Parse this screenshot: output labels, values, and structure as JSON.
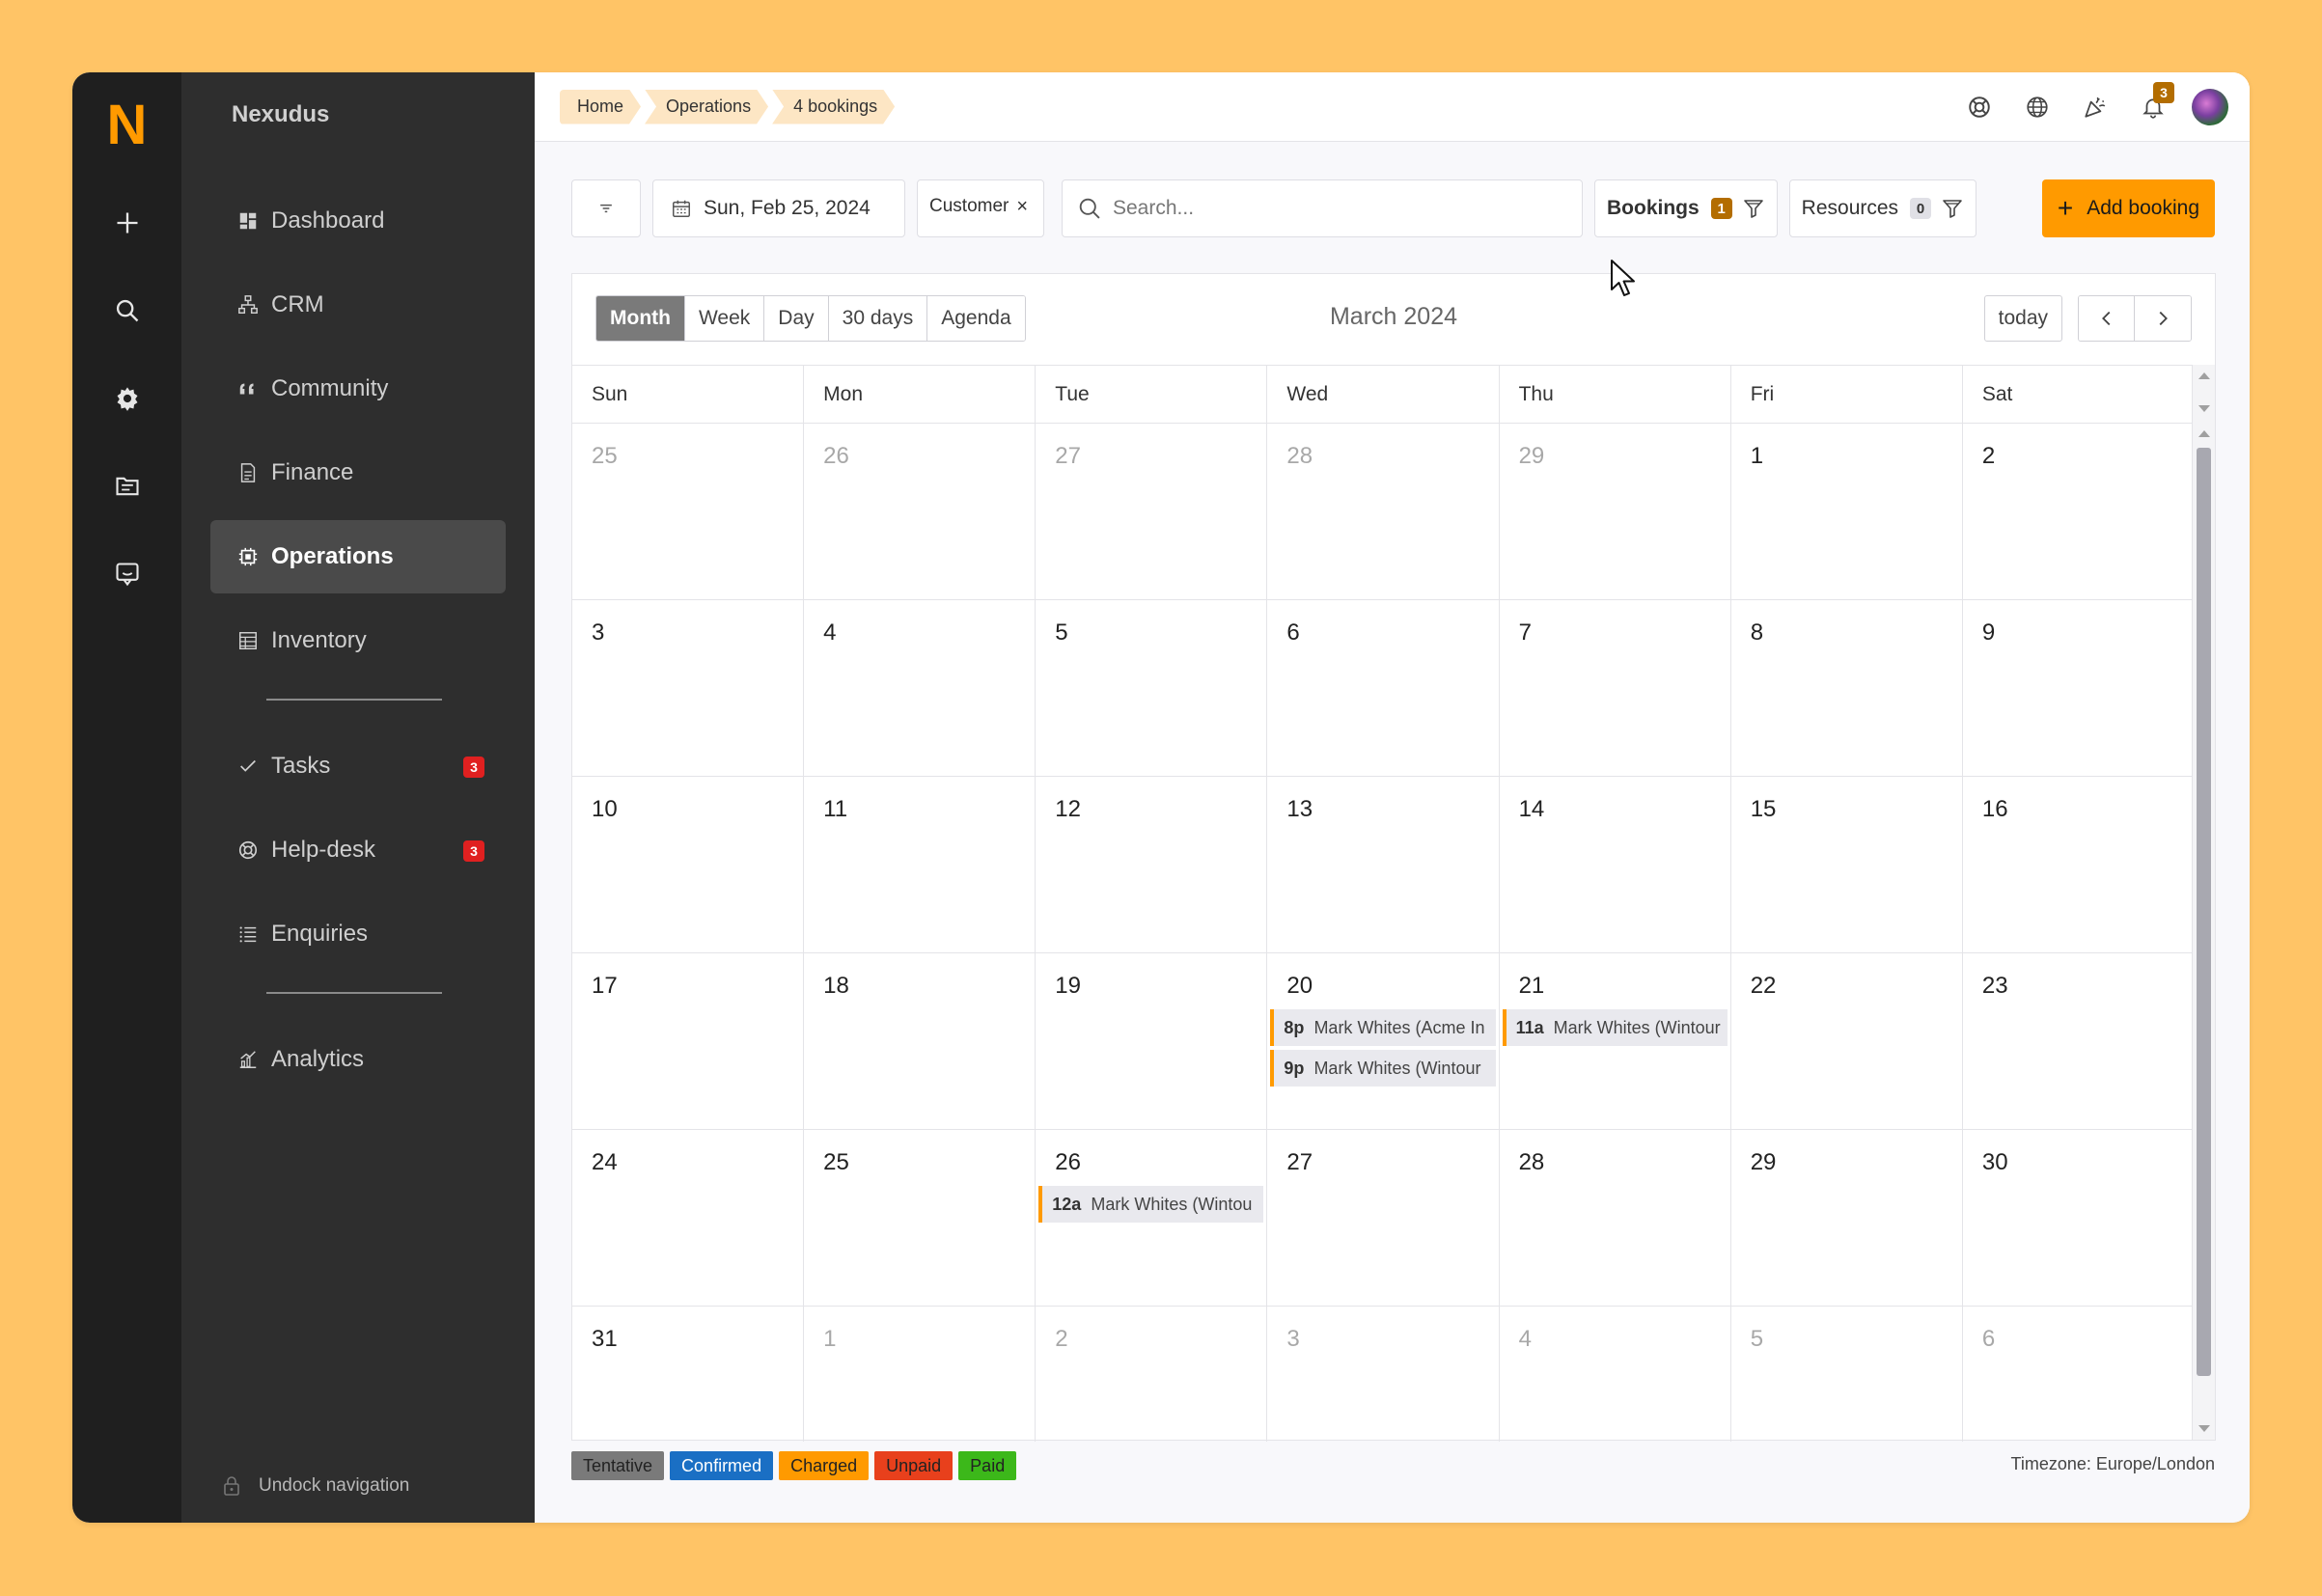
{
  "app": {
    "logo": "N",
    "brand": "Nexudus"
  },
  "rail": {
    "icons": [
      "plus-icon",
      "search-icon",
      "gear-icon",
      "folder-icon",
      "chat-icon"
    ]
  },
  "sidebar": {
    "items": [
      {
        "label": "Dashboard",
        "icon": "dashboard-icon"
      },
      {
        "label": "CRM",
        "icon": "crm-icon"
      },
      {
        "label": "Community",
        "icon": "quote-icon"
      },
      {
        "label": "Finance",
        "icon": "document-icon"
      },
      {
        "label": "Operations",
        "icon": "chip-icon",
        "active": true
      },
      {
        "label": "Inventory",
        "icon": "table-icon"
      }
    ],
    "items2": [
      {
        "label": "Tasks",
        "badge": "3"
      },
      {
        "label": "Help-desk",
        "badge": "3"
      },
      {
        "label": "Enquiries"
      }
    ],
    "items3": [
      {
        "label": "Analytics"
      }
    ],
    "undock": "Undock navigation"
  },
  "breadcrumb": [
    "Home",
    "Operations",
    "4 bookings"
  ],
  "topbar": {
    "notifications_count": "3"
  },
  "toolbar": {
    "date": "Sun, Feb 25, 2024",
    "customer_chip": "Customer",
    "search_placeholder": "Search...",
    "bookings_label": "Bookings",
    "bookings_count": "1",
    "resources_label": "Resources",
    "resources_count": "0",
    "add_label": "Add booking"
  },
  "calendar": {
    "views": [
      "Month",
      "Week",
      "Day",
      "30 days",
      "Agenda"
    ],
    "active_view": "Month",
    "title": "March 2024",
    "today_label": "today",
    "weekdays": [
      "Sun",
      "Mon",
      "Tue",
      "Wed",
      "Thu",
      "Fri",
      "Sat"
    ],
    "weeks": [
      [
        {
          "d": "25",
          "o": true
        },
        {
          "d": "26",
          "o": true
        },
        {
          "d": "27",
          "o": true
        },
        {
          "d": "28",
          "o": true
        },
        {
          "d": "29",
          "o": true
        },
        {
          "d": "1"
        },
        {
          "d": "2"
        }
      ],
      [
        {
          "d": "3"
        },
        {
          "d": "4"
        },
        {
          "d": "5"
        },
        {
          "d": "6"
        },
        {
          "d": "7"
        },
        {
          "d": "8"
        },
        {
          "d": "9"
        }
      ],
      [
        {
          "d": "10"
        },
        {
          "d": "11"
        },
        {
          "d": "12"
        },
        {
          "d": "13"
        },
        {
          "d": "14"
        },
        {
          "d": "15"
        },
        {
          "d": "16"
        }
      ],
      [
        {
          "d": "17"
        },
        {
          "d": "18"
        },
        {
          "d": "19"
        },
        {
          "d": "20",
          "events": [
            {
              "time": "8p",
              "title": "Mark Whites (Acme In"
            },
            {
              "time": "9p",
              "title": "Mark Whites (Wintour"
            }
          ]
        },
        {
          "d": "21",
          "events": [
            {
              "time": "11a",
              "title": "Mark Whites (Wintour"
            }
          ]
        },
        {
          "d": "22"
        },
        {
          "d": "23"
        }
      ],
      [
        {
          "d": "24"
        },
        {
          "d": "25"
        },
        {
          "d": "26",
          "events": [
            {
              "time": "12a",
              "title": "Mark Whites (Wintou"
            }
          ]
        },
        {
          "d": "27"
        },
        {
          "d": "28"
        },
        {
          "d": "29"
        },
        {
          "d": "30"
        }
      ],
      [
        {
          "d": "31"
        },
        {
          "d": "1",
          "o": true
        },
        {
          "d": "2",
          "o": true
        },
        {
          "d": "3",
          "o": true
        },
        {
          "d": "4",
          "o": true
        },
        {
          "d": "5",
          "o": true
        },
        {
          "d": "6",
          "o": true
        }
      ]
    ]
  },
  "legend": [
    {
      "label": "Tentative",
      "color": "#7a7a7a",
      "text": "#222222"
    },
    {
      "label": "Confirmed",
      "color": "#1a6fc4",
      "text": "#ffffff"
    },
    {
      "label": "Charged",
      "color": "#ff9a00",
      "text": "#222222"
    },
    {
      "label": "Unpaid",
      "color": "#e8401c",
      "text": "#222222"
    },
    {
      "label": "Paid",
      "color": "#3cb81a",
      "text": "#222222"
    }
  ],
  "timezone": "Timezone: Europe/London",
  "colors": {
    "accent": "#ff9a00",
    "background": "#ffc466",
    "badge_red": "#e02020",
    "bookings_badge": "#b36d00",
    "resources_badge": "#e0e0e6"
  }
}
